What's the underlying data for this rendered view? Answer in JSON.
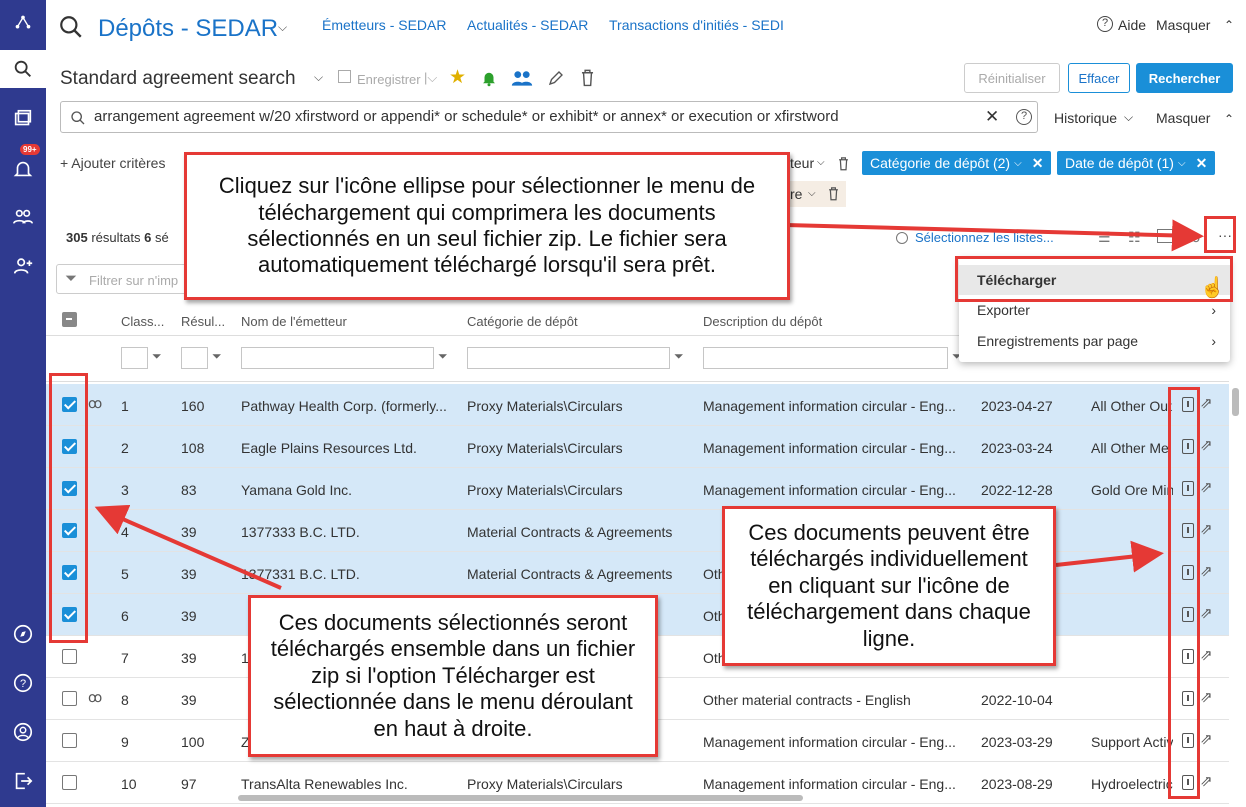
{
  "app": {
    "title": "Dépôts - SEDAR",
    "nav_links": [
      "Émetteurs - SEDAR",
      "Actualités - SEDAR",
      "Transactions d'initiés - SEDI"
    ],
    "help": "Aide",
    "hide": "Masquer"
  },
  "search": {
    "name": "Standard agreement search",
    "save": "Enregistrer",
    "query": "arrangement agreement w/20 xfirstword or appendi* or schedule* or exhibit* or annex* or execution or xfirstword",
    "history": "Historique",
    "hide": "Masquer",
    "reset": "Réinitialiser",
    "clear": "Effacer",
    "search": "Rechercher"
  },
  "criteria": {
    "add": "+ Ajouter critères",
    "chip_cut1": "teur",
    "chip_cut2": "re",
    "chip1": "Catégorie de dépôt (2)",
    "chip2": "Date de dépôt (1)"
  },
  "results": {
    "count": "305",
    "count_label": "résultats",
    "sel_count": "6",
    "sel_label": "sé",
    "select_lists": "Sélectionnez les listes...",
    "filter_placeholder": "Filtrer sur n'imp"
  },
  "menu": {
    "download": "Télécharger",
    "export": "Exporter",
    "per_page": "Enregistrements par page"
  },
  "columns": [
    "Class...",
    "Résul...",
    "Nom de l'émetteur",
    "Catégorie de dépôt",
    "Description du dépôt"
  ],
  "rows": [
    {
      "checked": true,
      "glasses": true,
      "n": "1",
      "res": "160",
      "issuer": "Pathway Health Corp. (formerly...",
      "cat": "Proxy Materials\\Circulars",
      "desc": "Management information circular - Eng...",
      "date": "2023-04-27",
      "extra": "All Other Out"
    },
    {
      "checked": true,
      "glasses": false,
      "n": "2",
      "res": "108",
      "issuer": "Eagle Plains Resources Ltd.",
      "cat": "Proxy Materials\\Circulars",
      "desc": "Management information circular - Eng...",
      "date": "2023-03-24",
      "extra": "All Other Me"
    },
    {
      "checked": true,
      "glasses": false,
      "n": "3",
      "res": "83",
      "issuer": "Yamana Gold Inc.",
      "cat": "Proxy Materials\\Circulars",
      "desc": "Management information circular - Eng...",
      "date": "2022-12-28",
      "extra": "Gold Ore Min"
    },
    {
      "checked": true,
      "glasses": false,
      "n": "4",
      "res": "39",
      "issuer": "1377333 B.C. LTD.",
      "cat": "Material Contracts & Agreements",
      "desc": "",
      "date": "",
      "extra": ""
    },
    {
      "checked": true,
      "glasses": false,
      "n": "5",
      "res": "39",
      "issuer": "1377331 B.C. LTD.",
      "cat": "Material Contracts & Agreements",
      "desc": "Oth",
      "date": "",
      "extra": ""
    },
    {
      "checked": true,
      "glasses": false,
      "n": "6",
      "res": "39",
      "issuer": "",
      "cat": "nts",
      "desc": "Oth",
      "date": "",
      "extra": ""
    },
    {
      "checked": false,
      "glasses": false,
      "n": "7",
      "res": "39",
      "issuer": "1",
      "cat": "nts",
      "desc": "Oth",
      "date": "",
      "extra": ""
    },
    {
      "checked": false,
      "glasses": true,
      "n": "8",
      "res": "39",
      "issuer": "",
      "cat": "nts",
      "desc": "Other material contracts - English",
      "date": "2022-10-04",
      "extra": ""
    },
    {
      "checked": false,
      "glasses": false,
      "n": "9",
      "res": "100",
      "issuer": "Z",
      "cat": "",
      "desc": "Management information circular - Eng...",
      "date": "2023-03-29",
      "extra": "Support Activ"
    },
    {
      "checked": false,
      "glasses": false,
      "n": "10",
      "res": "97",
      "issuer": "TransAlta Renewables Inc.",
      "cat": "Proxy Materials\\Circulars",
      "desc": "Management information circular - Eng...",
      "date": "2023-08-29",
      "extra": "Hydroelectric"
    }
  ],
  "callouts": {
    "top": "Cliquez sur l'icône ellipse pour sélectionner le menu de téléchargement qui comprimera les documents sélectionnés en un seul fichier zip. Le fichier sera automatiquement téléchargé lorsqu'il sera prêt.",
    "left": "Ces documents sélectionnés seront téléchargés ensemble dans un fichier zip si l'option Télécharger est sélectionnée dans le menu déroulant en haut à droite.",
    "right": "Ces documents peuvent être téléchargés individuellement en cliquant sur l'icône de téléchargement dans chaque ligne."
  },
  "colors": {
    "rail": "#2f3a8f",
    "accent": "#1a8fd8",
    "callout_border": "#e53935",
    "selected_row": "#d5e8f8"
  }
}
